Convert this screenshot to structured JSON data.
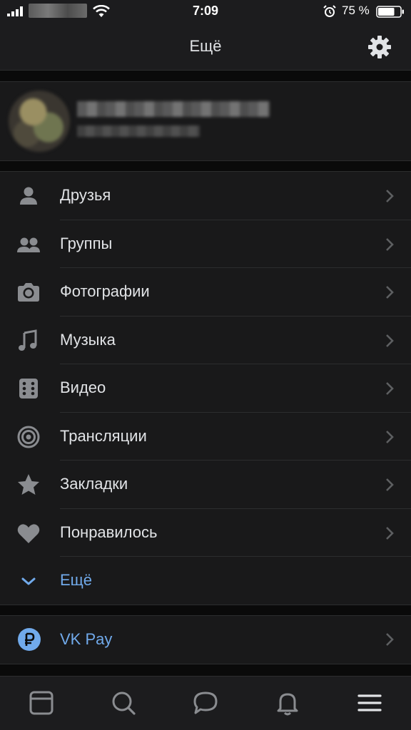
{
  "status_bar": {
    "time": "7:09",
    "battery_percent": "75 %",
    "battery_level": 0.75,
    "icons": [
      "signal-icon",
      "wifi-icon",
      "alarm-icon",
      "battery-icon"
    ]
  },
  "header": {
    "title": "Ещё",
    "settings_icon": "gear-icon"
  },
  "menu": {
    "items": [
      {
        "label": "Друзья",
        "icon": "person-icon"
      },
      {
        "label": "Группы",
        "icon": "group-icon"
      },
      {
        "label": "Фотографии",
        "icon": "camera-icon"
      },
      {
        "label": "Музыка",
        "icon": "music-note-icon"
      },
      {
        "label": "Видео",
        "icon": "video-icon"
      },
      {
        "label": "Трансляции",
        "icon": "broadcast-icon"
      },
      {
        "label": "Закладки",
        "icon": "star-icon"
      },
      {
        "label": "Понравилось",
        "icon": "heart-icon"
      }
    ],
    "more_label": "Ещё"
  },
  "vkpay": {
    "label": "VK Pay",
    "icon": "ruble-icon"
  },
  "tabbar": {
    "tabs": [
      "news-icon",
      "search-icon",
      "messages-icon",
      "notifications-icon",
      "menu-icon"
    ]
  },
  "colors": {
    "background": "#0a0a0a",
    "surface": "#19191a",
    "text": "#e1e3e6",
    "icon": "#8a8c90",
    "accent": "#71aaeb"
  }
}
